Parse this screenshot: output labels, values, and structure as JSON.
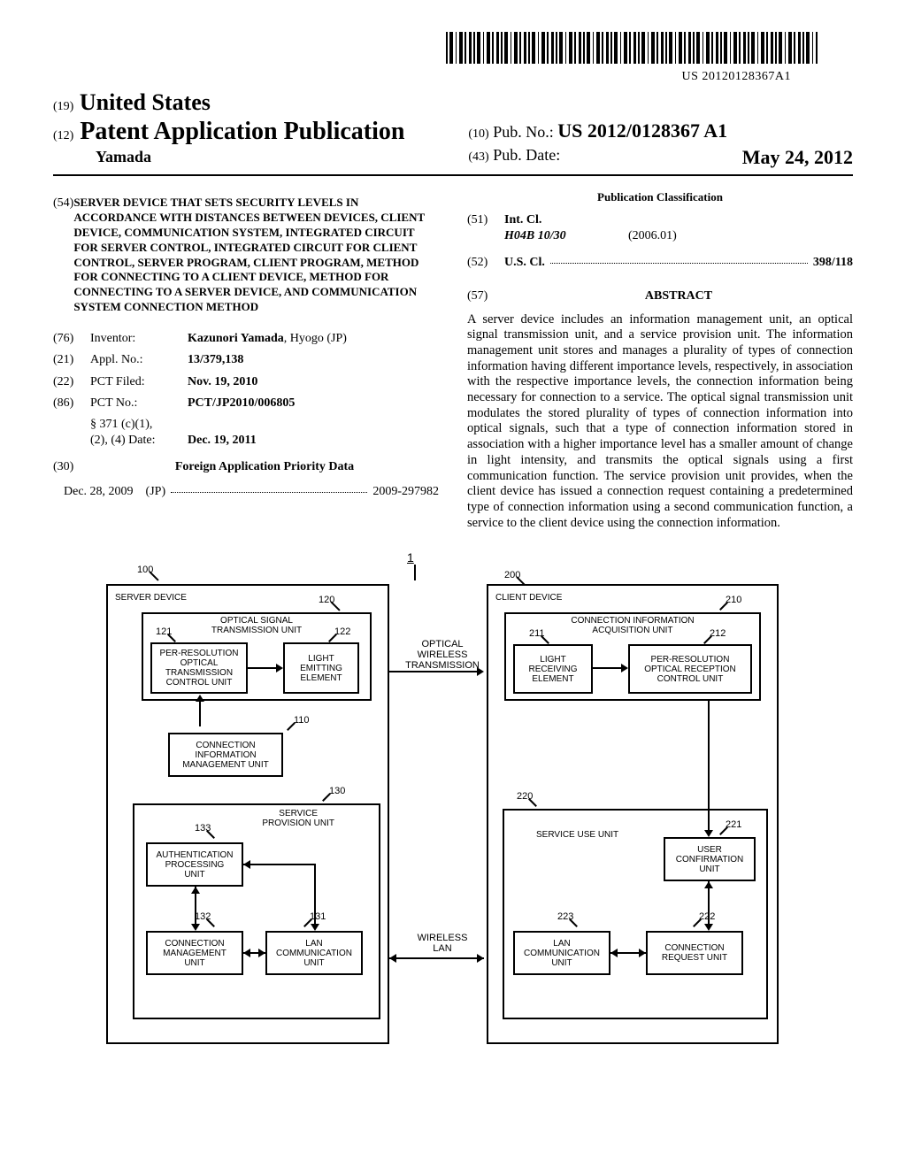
{
  "barcode_number": "US 20120128367A1",
  "header": {
    "country_prefix": "(19)",
    "country": "United States",
    "pub_prefix": "(12)",
    "pub_type": "Patent Application Publication",
    "author": "Yamada",
    "pubno_prefix": "(10)",
    "pubno_label": "Pub. No.:",
    "pubno_value": "US 2012/0128367 A1",
    "pubdate_prefix": "(43)",
    "pubdate_label": "Pub. Date:",
    "pubdate_value": "May 24, 2012"
  },
  "left": {
    "title_num": "(54)",
    "title": "SERVER DEVICE THAT SETS SECURITY LEVELS IN ACCORDANCE WITH DISTANCES BETWEEN DEVICES, CLIENT DEVICE, COMMUNICATION SYSTEM, INTEGRATED CIRCUIT FOR SERVER CONTROL, INTEGRATED CIRCUIT FOR CLIENT CONTROL, SERVER PROGRAM, CLIENT PROGRAM, METHOD FOR CONNECTING TO A CLIENT DEVICE, METHOD FOR CONNECTING TO A SERVER DEVICE, AND COMMUNICATION SYSTEM CONNECTION METHOD",
    "inventor_num": "(76)",
    "inventor_label": "Inventor:",
    "inventor_value": "Kazunori Yamada",
    "inventor_loc": ", Hyogo (JP)",
    "appl_num": "(21)",
    "appl_label": "Appl. No.:",
    "appl_value": "13/379,138",
    "pctfiled_num": "(22)",
    "pctfiled_label": "PCT Filed:",
    "pctfiled_value": "Nov. 19, 2010",
    "pctno_num": "(86)",
    "pctno_label": "PCT No.:",
    "pctno_value": "PCT/JP2010/006805",
    "s371_label": "§ 371 (c)(1),",
    "s371_label2": "(2), (4) Date:",
    "s371_value": "Dec. 19, 2011",
    "prio_num": "(30)",
    "prio_head": "Foreign Application Priority Data",
    "prio_date": "Dec. 28, 2009",
    "prio_cc": "(JP)",
    "prio_app": "2009-297982"
  },
  "right": {
    "class_head": "Publication Classification",
    "intcl_num": "(51)",
    "intcl_label": "Int. Cl.",
    "intcl_code": "H04B 10/30",
    "intcl_year": "(2006.01)",
    "uscl_num": "(52)",
    "uscl_label": "U.S. Cl.",
    "uscl_value": "398/118",
    "abs_num": "(57)",
    "abs_head": "ABSTRACT",
    "abs_text": "A server device includes an information management unit, an optical signal transmission unit, and a service provision unit. The information management unit stores and manages a plurality of types of connection information having different importance levels, respectively, in association with the respective importance levels, the connection information being necessary for connection to a service. The optical signal transmission unit modulates the stored plurality of types of connection information into optical signals, such that a type of connection information stored in association with a higher importance level has a smaller amount of change in light intensity, and transmits the optical signals using a first communication function. The service provision unit provides, when the client device has issued a connection request containing a predetermined type of connection information using a second communication function, a service to the client device using the connection information."
  },
  "figure": {
    "ref_1": "1",
    "ref_100": "100",
    "ref_200": "200",
    "server_device": "SERVER DEVICE",
    "ref_120": "120",
    "optical_signal_tx_unit": "OPTICAL SIGNAL\nTRANSMISSION UNIT",
    "ref_121": "121",
    "per_res_tx": "PER-RESOLUTION\nOPTICAL\nTRANSMISSION\nCONTROL UNIT",
    "ref_122": "122",
    "light_emit": "LIGHT\nEMITTING\nELEMENT",
    "ref_110": "110",
    "conn_info_mgmt": "CONNECTION\nINFORMATION\nMANAGEMENT UNIT",
    "ref_130": "130",
    "ref_133": "133",
    "auth_proc": "AUTHENTICATION\nPROCESSING\nUNIT",
    "service_prov": "SERVICE\nPROVISION UNIT",
    "ref_132": "132",
    "conn_mgmt": "CONNECTION\nMANAGEMENT\nUNIT",
    "ref_131": "131",
    "lan_comm_s": "LAN\nCOMMUNICATION\nUNIT",
    "optical_wireless": "OPTICAL\nWIRELESS\nTRANSMISSION",
    "wireless_lan": "WIRELESS\nLAN",
    "client_device": "CLIENT DEVICE",
    "ref_210": "210",
    "conn_info_acq": "CONNECTION INFORMATION\nACQUISITION UNIT",
    "ref_211": "211",
    "light_recv": "LIGHT\nRECEIVING\nELEMENT",
    "ref_212": "212",
    "per_res_rx": "PER-RESOLUTION\nOPTICAL RECEPTION\nCONTROL UNIT",
    "ref_220": "220",
    "ref_221": "221",
    "service_use": "SERVICE USE UNIT",
    "user_conf": "USER\nCONFIRMATION\nUNIT",
    "ref_223": "223",
    "lan_comm_c": "LAN\nCOMMUNICATION\nUNIT",
    "ref_222": "222",
    "conn_req": "CONNECTION\nREQUEST UNIT"
  }
}
